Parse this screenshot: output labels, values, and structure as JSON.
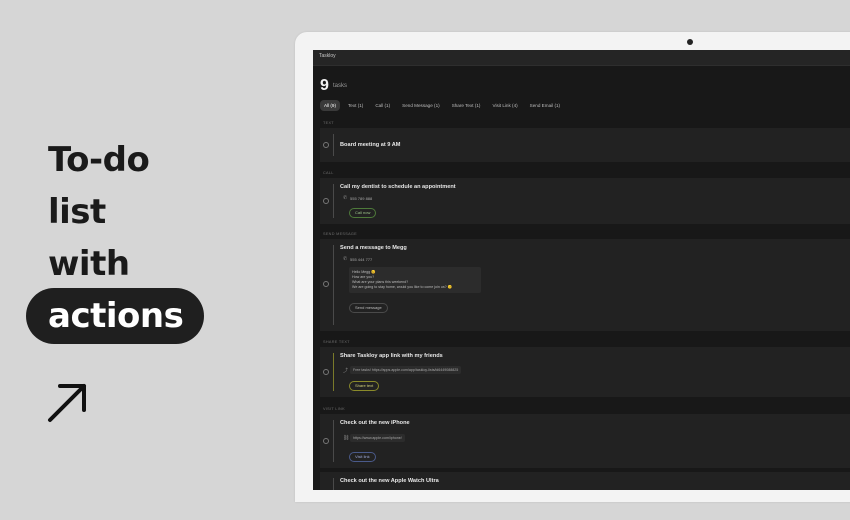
{
  "promo": {
    "line1": "To-do",
    "line2": "list",
    "line3": "with",
    "line4": "actions"
  },
  "app": {
    "window_title": "Taskloy",
    "task_count": "9",
    "task_count_label": "tasks",
    "filters": [
      {
        "label": "All (9)",
        "active": true
      },
      {
        "label": "Text (1)"
      },
      {
        "label": "Call (1)"
      },
      {
        "label": "Send Message (1)"
      },
      {
        "label": "Share Text (1)"
      },
      {
        "label": "Visit Link (4)"
      },
      {
        "label": "Send Email (1)"
      }
    ],
    "sections": {
      "text": "TEXT",
      "call": "CALL",
      "send_message": "SEND MESSAGE",
      "share_text": "SHARE TEXT",
      "visit_link": "VISIT LINK"
    },
    "tasks": {
      "t1_title": "Board meeting at 9 AM",
      "t2_title": "Call my dentist to schedule an appointment",
      "t2_phone": "555 789 888",
      "t2_button": "Call now",
      "t3_title": "Send a message to Megg",
      "t3_phone": "555 444 777",
      "t3_msg_line1": "Hello Megg 😊",
      "t3_msg_line2": "How are you?",
      "t3_msg_line3": "What are your plans this weekend?",
      "t3_msg_line4": "We are going to stay home, would you like to come join us? 🙂",
      "t3_button": "Send message",
      "t4_title": "Share Taskloy app link with my friends",
      "t4_text": "Free tasks! https://apps.apple.com/app/taskloy-lists/id6449088825",
      "t4_button": "Share text",
      "t5_title": "Check out the new iPhone",
      "t5_link": "https://www.apple.com/iphone/",
      "t5_button": "Visit link",
      "t6_title": "Check out the new Apple Watch Ultra"
    }
  }
}
